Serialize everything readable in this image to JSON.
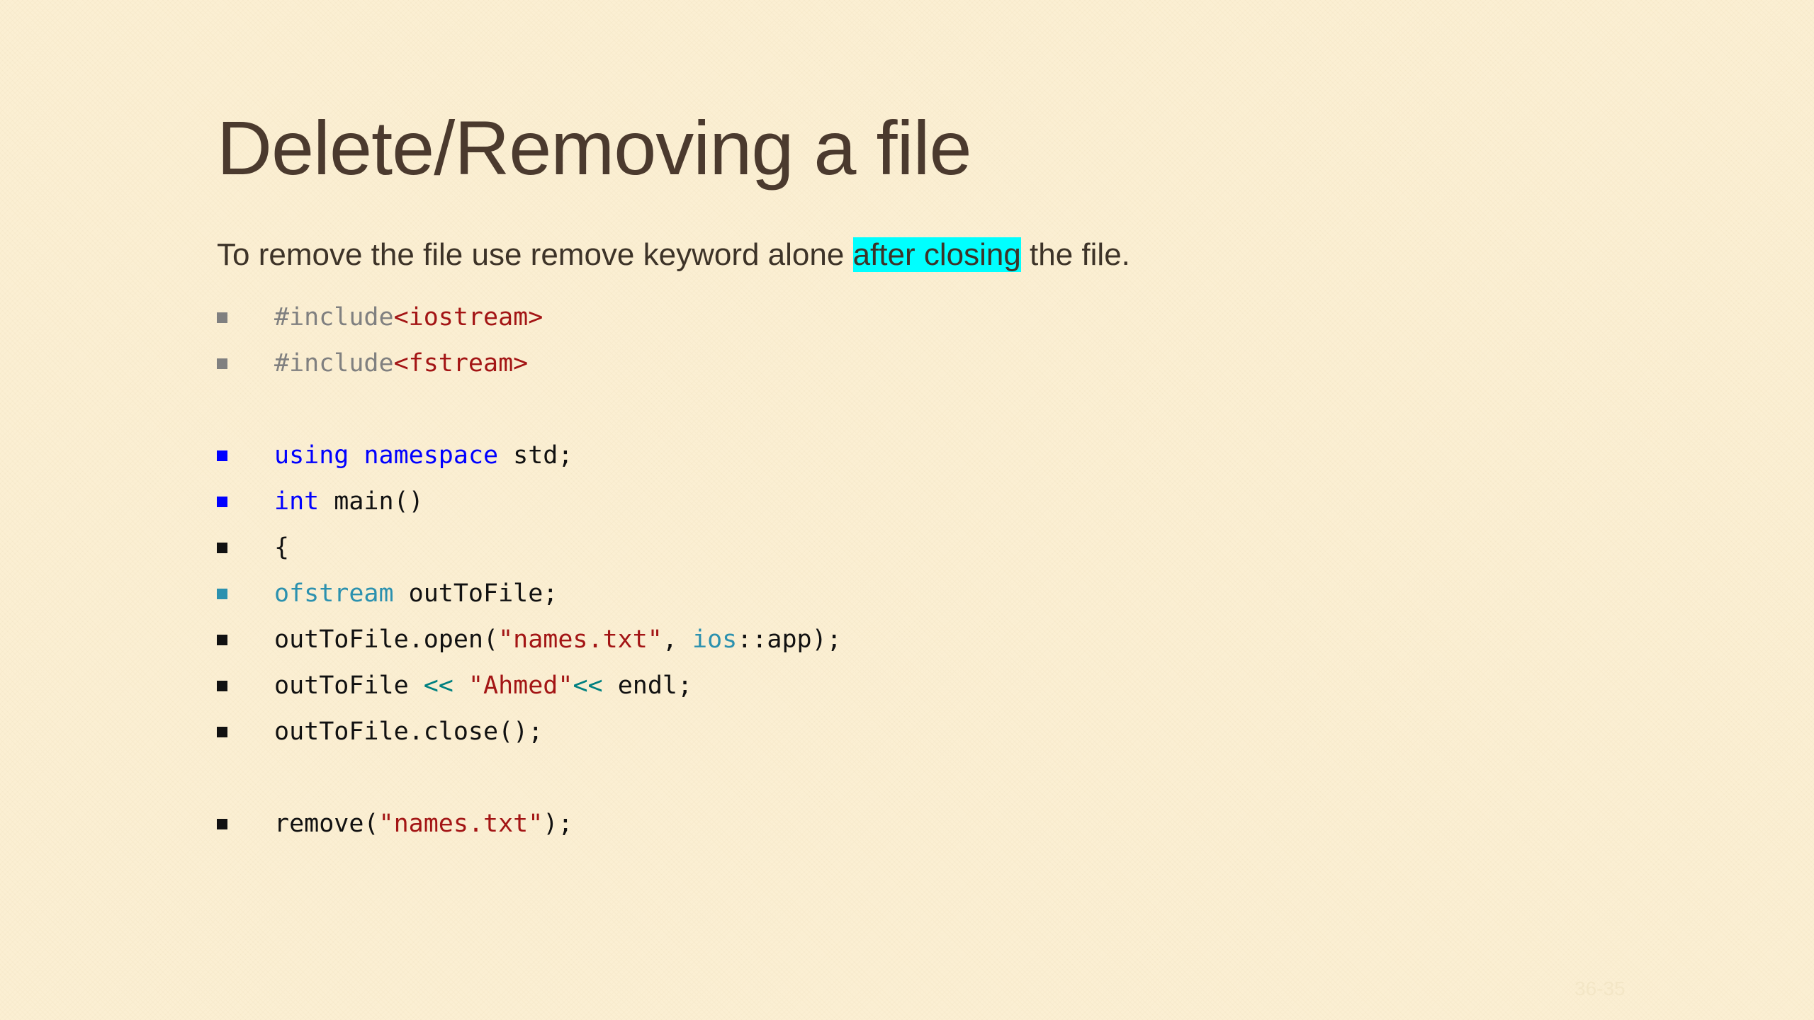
{
  "slide": {
    "title": "Delete/Removing a file",
    "subtitle": {
      "before": "To remove the file use remove keyword alone ",
      "highlight": "after closing",
      "after": " the file."
    },
    "code": {
      "l1": {
        "a": "#include",
        "b": "<iostream>"
      },
      "l2": {
        "a": "#include",
        "b": "<fstream>"
      },
      "l3": {
        "a": "using",
        "b": " ",
        "c": "namespace",
        "d": " std;"
      },
      "l4": {
        "a": "int",
        "b": " main()"
      },
      "l5": {
        "a": "{"
      },
      "l6": {
        "a": "ofstream",
        "b": " outToFile;"
      },
      "l7": {
        "a": "outToFile.open(",
        "b": "\"names.txt\"",
        "c": ", ",
        "d": "ios",
        "e": "::app);"
      },
      "l8": {
        "a": "outToFile ",
        "b": "<<",
        "c": " ",
        "d": "\"Ahmed\"",
        "e": "<<",
        "f": " endl;"
      },
      "l9": {
        "a": "outToFile.close();"
      },
      "l10": {
        "a": "remove(",
        "b": "\"names.txt\"",
        "c": ");"
      }
    },
    "page_number": "36-35"
  },
  "colors": {
    "background": "#fbefd3",
    "title": "#4b3a2e",
    "highlight": "#00ffff",
    "keyword": "#0000ff",
    "type": "#2b91af",
    "string": "#a31515",
    "preprocessor": "#808080",
    "operator": "#008080"
  },
  "icons": {
    "bullet": "square-bullet-icon"
  }
}
